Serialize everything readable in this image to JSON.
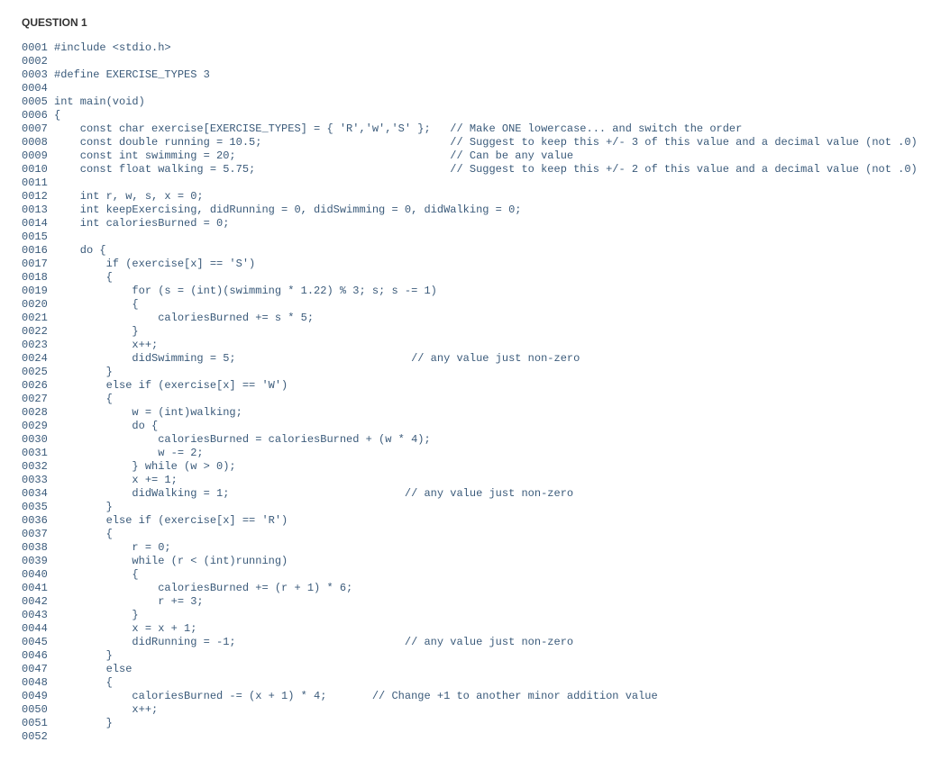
{
  "title": "QUESTION 1",
  "code": {
    "lines": [
      {
        "n": "0001",
        "t": "#include <stdio.h>"
      },
      {
        "n": "0002",
        "t": ""
      },
      {
        "n": "0003",
        "t": "#define EXERCISE_TYPES 3"
      },
      {
        "n": "0004",
        "t": ""
      },
      {
        "n": "0005",
        "t": "int main(void)"
      },
      {
        "n": "0006",
        "t": "{"
      },
      {
        "n": "0007",
        "t": "    const char exercise[EXERCISE_TYPES] = { 'R','w','S' };   // Make ONE lowercase... and switch the order"
      },
      {
        "n": "0008",
        "t": "    const double running = 10.5;                             // Suggest to keep this +/- 3 of this value and a decimal value (not .0)"
      },
      {
        "n": "0009",
        "t": "    const int swimming = 20;                                 // Can be any value"
      },
      {
        "n": "0010",
        "t": "    const float walking = 5.75;                              // Suggest to keep this +/- 2 of this value and a decimal value (not .0)"
      },
      {
        "n": "0011",
        "t": ""
      },
      {
        "n": "0012",
        "t": "    int r, w, s, x = 0;"
      },
      {
        "n": "0013",
        "t": "    int keepExercising, didRunning = 0, didSwimming = 0, didWalking = 0;"
      },
      {
        "n": "0014",
        "t": "    int caloriesBurned = 0;"
      },
      {
        "n": "0015",
        "t": ""
      },
      {
        "n": "0016",
        "t": "    do {"
      },
      {
        "n": "0017",
        "t": "        if (exercise[x] == 'S')"
      },
      {
        "n": "0018",
        "t": "        {"
      },
      {
        "n": "0019",
        "t": "            for (s = (int)(swimming * 1.22) % 3; s; s -= 1)"
      },
      {
        "n": "0020",
        "t": "            {"
      },
      {
        "n": "0021",
        "t": "                caloriesBurned += s * 5;"
      },
      {
        "n": "0022",
        "t": "            }"
      },
      {
        "n": "0023",
        "t": "            x++;"
      },
      {
        "n": "0024",
        "t": "            didSwimming = 5;                           // any value just non-zero"
      },
      {
        "n": "0025",
        "t": "        }"
      },
      {
        "n": "0026",
        "t": "        else if (exercise[x] == 'W')"
      },
      {
        "n": "0027",
        "t": "        {"
      },
      {
        "n": "0028",
        "t": "            w = (int)walking;"
      },
      {
        "n": "0029",
        "t": "            do {"
      },
      {
        "n": "0030",
        "t": "                caloriesBurned = caloriesBurned + (w * 4);"
      },
      {
        "n": "0031",
        "t": "                w -= 2;"
      },
      {
        "n": "0032",
        "t": "            } while (w > 0);"
      },
      {
        "n": "0033",
        "t": "            x += 1;"
      },
      {
        "n": "0034",
        "t": "            didWalking = 1;                           // any value just non-zero"
      },
      {
        "n": "0035",
        "t": "        }"
      },
      {
        "n": "0036",
        "t": "        else if (exercise[x] == 'R')"
      },
      {
        "n": "0037",
        "t": "        {"
      },
      {
        "n": "0038",
        "t": "            r = 0;"
      },
      {
        "n": "0039",
        "t": "            while (r < (int)running)"
      },
      {
        "n": "0040",
        "t": "            {"
      },
      {
        "n": "0041",
        "t": "                caloriesBurned += (r + 1) * 6;"
      },
      {
        "n": "0042",
        "t": "                r += 3;"
      },
      {
        "n": "0043",
        "t": "            }"
      },
      {
        "n": "0044",
        "t": "            x = x + 1;"
      },
      {
        "n": "0045",
        "t": "            didRunning = -1;                          // any value just non-zero"
      },
      {
        "n": "0046",
        "t": "        }"
      },
      {
        "n": "0047",
        "t": "        else"
      },
      {
        "n": "0048",
        "t": "        {"
      },
      {
        "n": "0049",
        "t": "            caloriesBurned -= (x + 1) * 4;       // Change +1 to another minor addition value"
      },
      {
        "n": "0050",
        "t": "            x++;"
      },
      {
        "n": "0051",
        "t": "        }"
      },
      {
        "n": "0052",
        "t": ""
      }
    ]
  }
}
